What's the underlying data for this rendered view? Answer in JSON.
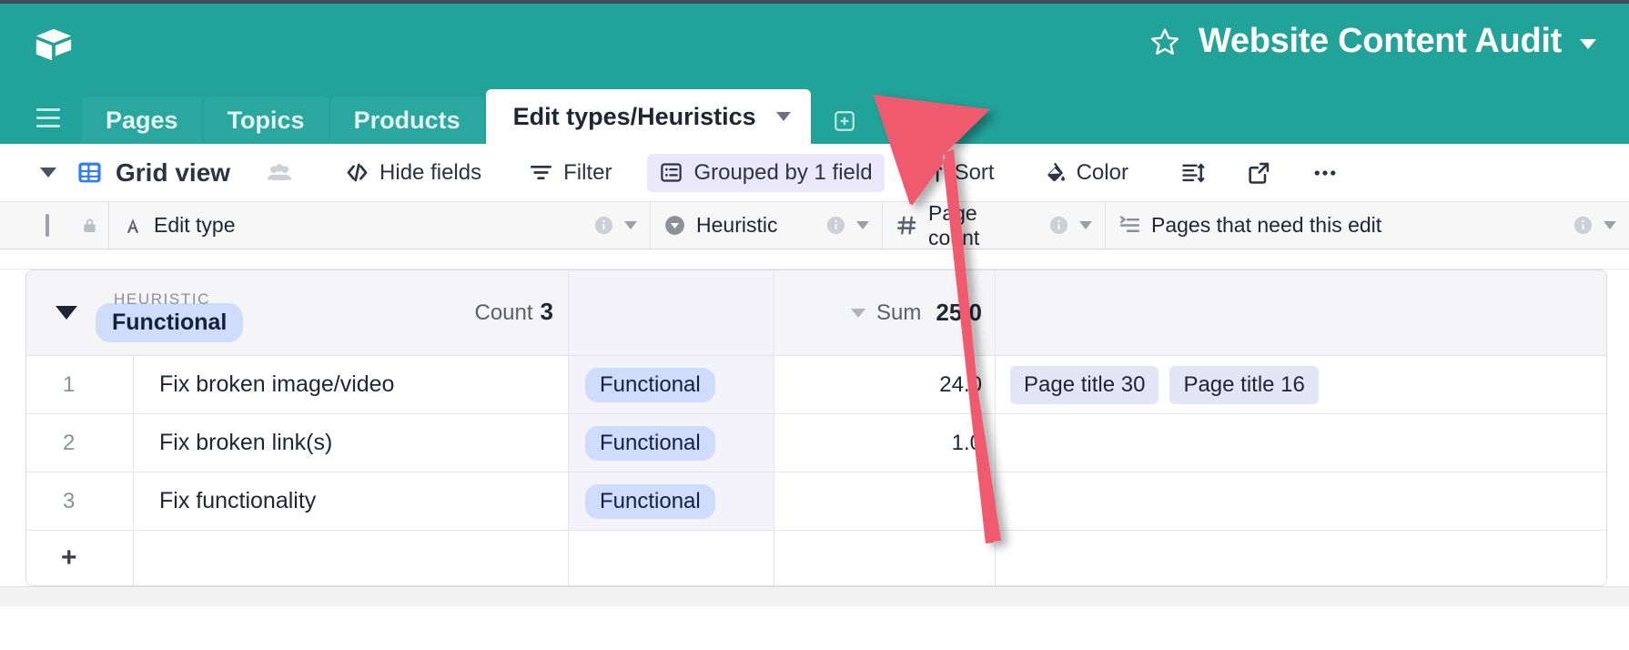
{
  "header": {
    "app_title": "Website Content Audit",
    "star_icon": "star-outline-icon",
    "logo_icon": "airtable-logo-icon",
    "caret_icon": "chevron-down-icon",
    "brand_color": "#21a39a"
  },
  "tabs": {
    "menu_icon": "hamburger-menu-icon",
    "items": [
      {
        "label": "Pages",
        "active": false
      },
      {
        "label": "Topics",
        "active": false
      },
      {
        "label": "Products",
        "active": false
      },
      {
        "label": "Edit types/Heuristics",
        "active": true
      }
    ],
    "add_label": "+"
  },
  "toolbar": {
    "view_name": "Grid view",
    "view_icon": "grid-view-icon",
    "collaborators_icon": "people-icon",
    "hide_fields_label": "Hide fields",
    "hide_fields_icon": "hide-fields-icon",
    "filter_label": "Filter",
    "filter_icon": "filter-icon",
    "group_label": "Grouped by 1 field",
    "group_icon": "group-icon",
    "group_highlight_color": "#ece8fb",
    "sort_label": "Sort",
    "sort_icon": "sort-icon",
    "color_label": "Color",
    "color_icon": "paint-bucket-icon",
    "row_height_icon": "row-height-icon",
    "share_icon": "share-export-icon",
    "more_icon": "more-horizontal-icon"
  },
  "columns": [
    {
      "label": "Edit type",
      "type_icon": "text-field-icon",
      "lock_icon": "lock-icon",
      "info_icon": "info-icon",
      "menu_icon": "chevron-down-icon"
    },
    {
      "label": "Heuristic",
      "type_icon": "single-select-icon",
      "info_icon": "info-icon",
      "menu_icon": "chevron-down-icon"
    },
    {
      "label": "Page count",
      "type_icon": "number-icon",
      "info_icon": "info-icon",
      "menu_icon": "chevron-down-icon"
    },
    {
      "label": "Pages that need this edit",
      "type_icon": "linked-record-icon",
      "info_icon": "info-icon",
      "menu_icon": "chevron-down-icon"
    }
  ],
  "group": {
    "field_label": "HEURISTIC",
    "value": "Functional",
    "collapse_icon": "triangle-down-icon",
    "count_label": "Count",
    "count_value": "3",
    "summary_label": "Sum",
    "summary_value": "25.0",
    "summary_caret_icon": "chevron-down-icon",
    "pill_color": "#cfdcfb"
  },
  "rows": [
    {
      "index": "1",
      "edit_type": "Fix broken image/video",
      "heuristic": "Functional",
      "page_count": "24.0",
      "pages": [
        "Page title 30",
        "Page title 16"
      ]
    },
    {
      "index": "2",
      "edit_type": "Fix broken link(s)",
      "heuristic": "Functional",
      "page_count": "1.0",
      "pages": []
    },
    {
      "index": "3",
      "edit_type": "Fix functionality",
      "heuristic": "Functional",
      "page_count": "",
      "pages": []
    }
  ],
  "add_row": {
    "label": "+",
    "icon": "plus-icon"
  },
  "annotation": {
    "arrow_icon": "red-arrow-pointer",
    "arrow_color": "#ef5a6e"
  }
}
